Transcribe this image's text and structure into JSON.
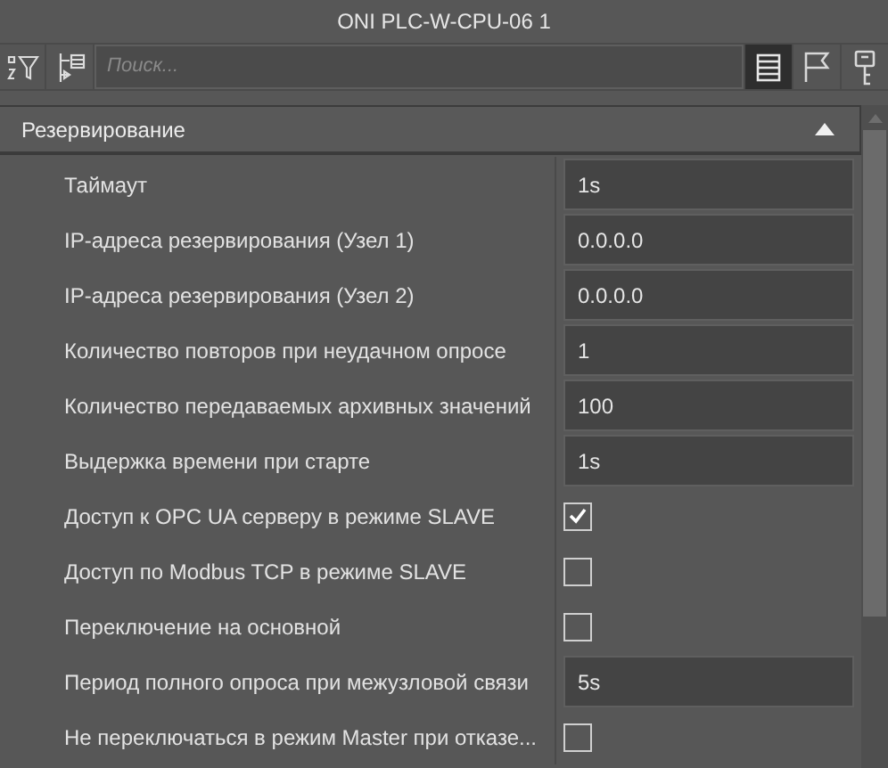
{
  "window": {
    "title": "ONI PLC-W-CPU-06 1"
  },
  "toolbar": {
    "search": {
      "placeholder": "Поиск..."
    },
    "view_buttons": [
      {
        "selected": true
      },
      {
        "selected": false
      },
      {
        "selected": false
      }
    ]
  },
  "section": {
    "title": "Резервирование",
    "expanded": true,
    "rows": [
      {
        "kind": "text",
        "label": "Таймаут",
        "value": "1s"
      },
      {
        "kind": "text",
        "label": "IP-адреса резервирования (Узел 1)",
        "value": "0.0.0.0"
      },
      {
        "kind": "text",
        "label": "IP-адреса резервирования (Узел 2)",
        "value": "0.0.0.0"
      },
      {
        "kind": "text",
        "label": "Количество повторов при неудачном опросе",
        "value": "1"
      },
      {
        "kind": "text",
        "label": "Количество передаваемых архивных значений",
        "value": "100"
      },
      {
        "kind": "text",
        "label": "Выдержка времени при старте",
        "value": "1s"
      },
      {
        "kind": "checkbox",
        "label": "Доступ к OPC UA серверу в режиме SLAVE",
        "checked": true
      },
      {
        "kind": "checkbox",
        "label": "Доступ по Modbus TCP в режиме SLAVE",
        "checked": false
      },
      {
        "kind": "checkbox",
        "label": "Переключение на основной",
        "checked": false
      },
      {
        "kind": "text",
        "label": "Период полного опроса при межузловой связи",
        "value": "5s"
      },
      {
        "kind": "checkbox",
        "label": "Не переключаться в режим Master при отказе...",
        "checked": false
      }
    ]
  }
}
